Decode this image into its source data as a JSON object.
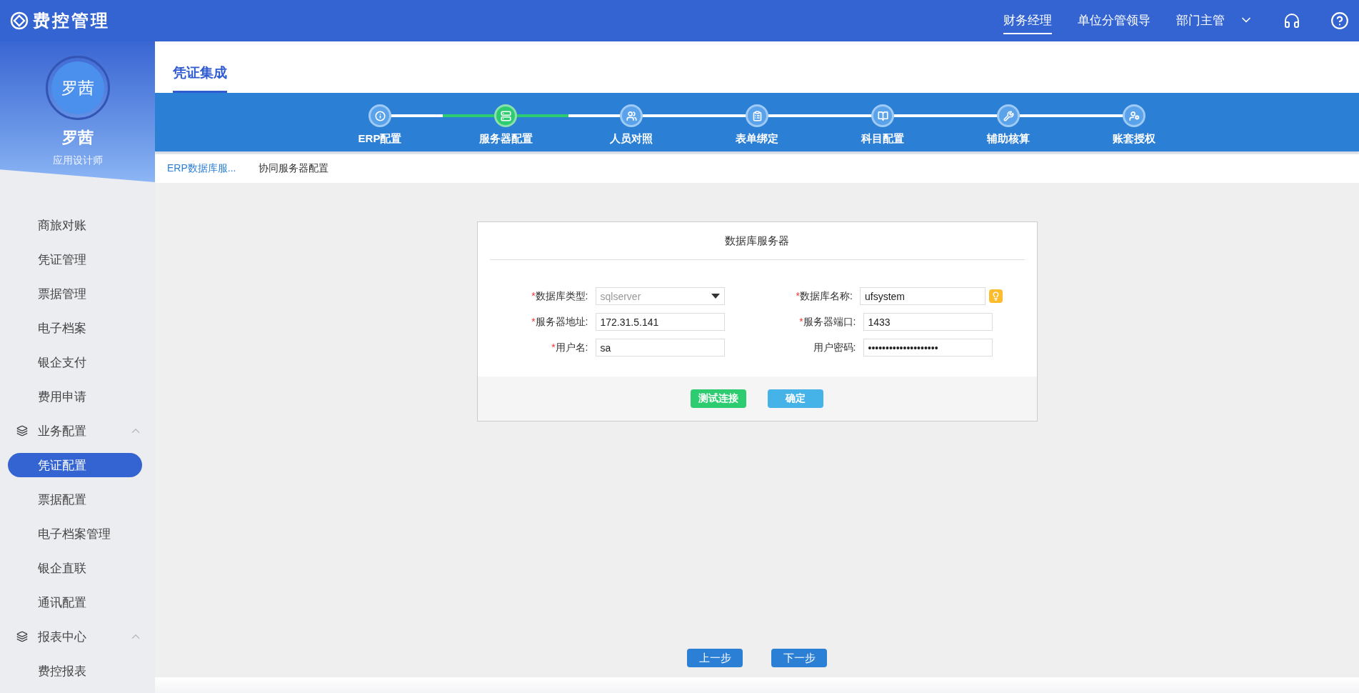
{
  "app": {
    "title": "费控管理"
  },
  "top_nav": [
    {
      "label": "财务经理",
      "selected": true,
      "dropdown": false
    },
    {
      "label": "单位分管领导",
      "selected": false,
      "dropdown": false
    },
    {
      "label": "部门主管",
      "selected": false,
      "dropdown": true
    }
  ],
  "user": {
    "avatar_text": "罗茜",
    "name": "罗茜",
    "role": "应用设计师"
  },
  "sidebar": {
    "items": [
      {
        "kind": "item",
        "label": "商旅对账",
        "selected": false
      },
      {
        "kind": "item",
        "label": "凭证管理",
        "selected": false
      },
      {
        "kind": "item",
        "label": "票据管理",
        "selected": false
      },
      {
        "kind": "item",
        "label": "电子档案",
        "selected": false
      },
      {
        "kind": "item",
        "label": "银企支付",
        "selected": false
      },
      {
        "kind": "item",
        "label": "费用申请",
        "selected": false
      },
      {
        "kind": "group",
        "label": "业务配置",
        "expanded": true
      },
      {
        "kind": "item",
        "label": "凭证配置",
        "selected": true
      },
      {
        "kind": "item",
        "label": "票据配置",
        "selected": false
      },
      {
        "kind": "item",
        "label": "电子档案管理",
        "selected": false
      },
      {
        "kind": "item",
        "label": "银企直联",
        "selected": false
      },
      {
        "kind": "item",
        "label": "通讯配置",
        "selected": false
      },
      {
        "kind": "group",
        "label": "报表中心",
        "expanded": true
      },
      {
        "kind": "item",
        "label": "费控报表",
        "selected": false
      }
    ]
  },
  "page_title": "凭证集成",
  "steps": [
    {
      "label": "ERP配置",
      "selected": false
    },
    {
      "label": "服务器配置",
      "selected": true
    },
    {
      "label": "人员对照",
      "selected": false
    },
    {
      "label": "表单绑定",
      "selected": false
    },
    {
      "label": "科目配置",
      "selected": false
    },
    {
      "label": "辅助核算",
      "selected": false
    },
    {
      "label": "账套授权",
      "selected": false
    }
  ],
  "sub_tabs": [
    {
      "label": "ERP数据库服...",
      "selected": true
    },
    {
      "label": "协同服务器配置",
      "selected": false
    }
  ],
  "form": {
    "title": "数据库服务器",
    "required_mark": "*",
    "fields": [
      {
        "label": "数据库类型:",
        "required": true,
        "kind": "select",
        "value": "sqlserver"
      },
      {
        "label": "数据库名称:",
        "required": true,
        "kind": "text",
        "value": "ufsystem",
        "hint": true
      },
      {
        "label": "服务器地址:",
        "required": true,
        "kind": "text",
        "value": "172.31.5.141"
      },
      {
        "label": "服务器端口:",
        "required": true,
        "kind": "text",
        "value": "1433"
      },
      {
        "label": "用户名:",
        "required": true,
        "kind": "text",
        "value": "sa"
      },
      {
        "label": "用户密码:",
        "required": false,
        "kind": "text",
        "value": "••••••••••••••••••••"
      }
    ],
    "buttons": [
      {
        "label": "测试连接",
        "kind": "success"
      },
      {
        "label": "确定",
        "kind": "info"
      }
    ]
  },
  "nav_buttons": [
    "上一步",
    "下一步"
  ]
}
